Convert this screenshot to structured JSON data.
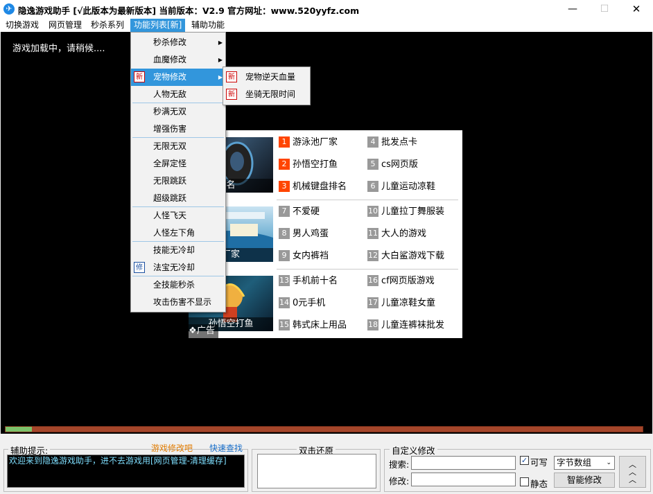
{
  "window": {
    "title": "隐逸游戏助手 [√此版本为最新版本] 当前版本：V2.9 官方网址：www.520yyfz.com",
    "minimize_glyph": "—",
    "maximize_glyph": "☐",
    "close_glyph": "✕",
    "icon": "feather-icon"
  },
  "menubar": [
    "切换游戏",
    "网页管理",
    "秒杀系列",
    "功能列表[新]",
    "辅助功能"
  ],
  "game": {
    "loading_text": "游戏加载中，请稍候...."
  },
  "dropdown": {
    "items": [
      {
        "label": "秒杀修改",
        "submenu": true
      },
      {
        "label": "血魔修改",
        "submenu": true
      },
      {
        "label": "宠物修改",
        "submenu": true,
        "badge": "新",
        "highlighted": true
      },
      {
        "label": "人物无敌"
      },
      {
        "label": "秒满无双"
      },
      {
        "label": "增强伤害"
      },
      {
        "label": "无限无双"
      },
      {
        "label": "全屏定怪"
      },
      {
        "label": "无限跳跃"
      },
      {
        "label": "超级跳跃"
      },
      {
        "label": "人怪飞天"
      },
      {
        "label": "人怪左下角"
      },
      {
        "label": "技能无冷却"
      },
      {
        "label": "法宝无冷却",
        "badge": "修"
      },
      {
        "label": "全技能秒杀"
      },
      {
        "label": "攻击伤害不显示"
      }
    ]
  },
  "submenu": {
    "items": [
      {
        "label": "宠物逆天血量",
        "badge": "新"
      },
      {
        "label": "坐骑无限时间",
        "badge": "新"
      }
    ]
  },
  "ads": {
    "image_labels": [
      "名",
      "厂家",
      "孙悟空打鱼"
    ],
    "tag": "广告",
    "links": [
      {
        "num": "1",
        "text": "游泳池厂家",
        "hot": true
      },
      {
        "num": "2",
        "text": "孙悟空打鱼",
        "hot": true
      },
      {
        "num": "3",
        "text": "机械键盘排名",
        "hot": true
      },
      {
        "num": "4",
        "text": "批发点卡"
      },
      {
        "num": "5",
        "text": "cs网页版"
      },
      {
        "num": "6",
        "text": "儿童运动凉鞋"
      },
      {
        "num": "7",
        "text": "不爱硬"
      },
      {
        "num": "8",
        "text": "男人鸡蛋"
      },
      {
        "num": "9",
        "text": "女内裤裆"
      },
      {
        "num": "10",
        "text": "儿童拉丁舞服装"
      },
      {
        "num": "11",
        "text": "大人的游戏"
      },
      {
        "num": "12",
        "text": "大白鲨游戏下载"
      },
      {
        "num": "13",
        "text": "手机前十名"
      },
      {
        "num": "14",
        "text": "0元手机"
      },
      {
        "num": "15",
        "text": "韩式床上用品"
      },
      {
        "num": "16",
        "text": "cf网页版游戏"
      },
      {
        "num": "17",
        "text": "儿童凉鞋女童"
      },
      {
        "num": "18",
        "text": "儿童连裤袜批发"
      }
    ]
  },
  "progress": {
    "value": 0.041,
    "fill_color": "#7cc26a",
    "track_color": "#a5462a"
  },
  "hint": {
    "title": "辅助提示:",
    "text": "欢迎来到隐逸游戏助手，进不去游戏用[网页管理-清理缓存]",
    "link_forum": "游戏修改吧",
    "link_search": "快速查找"
  },
  "restore": {
    "title": "双击还原"
  },
  "custom": {
    "title": "自定义修改",
    "search_label": "搜索:",
    "modify_label": "修改:",
    "writable_label": "可写",
    "writable_checked": true,
    "static_label": "静态",
    "static_checked": false,
    "type_value": "字节数组",
    "smart_button": "智能修改",
    "check_mark": "✓",
    "dropdown_glyph": "⌄",
    "up_glyphs": [
      "︿",
      "︿",
      "︿"
    ]
  },
  "colors": {
    "menu_highlight": "#3296dc",
    "hot_number": "#ff4500",
    "hint_text": "#7fdfff",
    "link_orange": "#e07b00",
    "link_blue": "#1a6fc9"
  }
}
